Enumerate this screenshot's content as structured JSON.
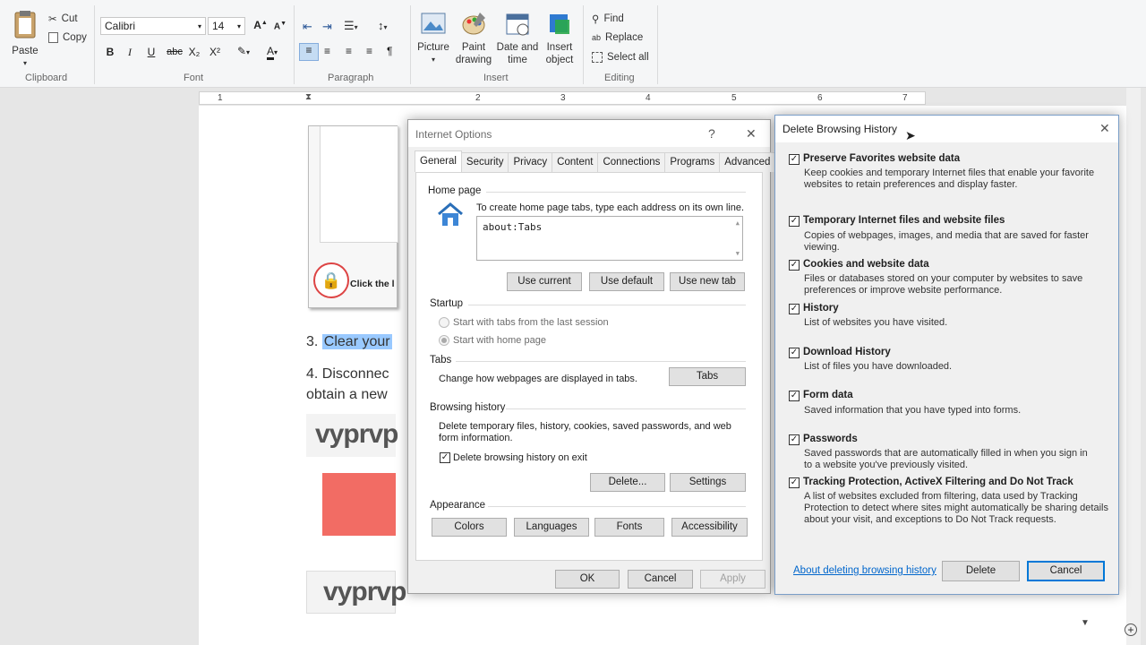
{
  "ribbon": {
    "clipboard": {
      "paste": "Paste",
      "cut": "Cut",
      "copy": "Copy",
      "label": "Clipboard"
    },
    "font": {
      "family": "Calibri",
      "size": "14",
      "label": "Font",
      "bold": "B",
      "italic": "I",
      "underline": "U",
      "strike": "abc",
      "sub": "X₂",
      "sup": "X²",
      "color_glyph": "A"
    },
    "paragraph": {
      "label": "Paragraph"
    },
    "insert": {
      "picture": "Picture",
      "paint_1": "Paint",
      "paint_2": "drawing",
      "date_1": "Date and",
      "date_2": "time",
      "insert_obj_1": "Insert",
      "insert_obj_2": "object",
      "label": "Insert"
    },
    "editing": {
      "find": "Find",
      "replace": "Replace",
      "select_all": "Select all",
      "label": "Editing"
    }
  },
  "ruler": {
    "marks": [
      "1",
      "2",
      "3",
      "4",
      "5",
      "6",
      "7"
    ]
  },
  "document": {
    "img_caption": "Click the l",
    "step3_num": "3.",
    "step3_text": "Clear your",
    "step4_line1": "4. Disconnec",
    "step4_line2": "obtain a new",
    "logo1": "vyprvp",
    "logo2": "vyprvp"
  },
  "internet_options": {
    "title": "Internet Options",
    "help": "?",
    "close": "✕",
    "tabs": [
      "General",
      "Security",
      "Privacy",
      "Content",
      "Connections",
      "Programs",
      "Advanced"
    ],
    "home_page": {
      "heading": "Home page",
      "desc": "To create home page tabs, type each address on its own line.",
      "value": "about:Tabs",
      "use_current": "Use current",
      "use_default": "Use default",
      "use_new_tab": "Use new tab"
    },
    "startup": {
      "heading": "Startup",
      "opt1": "Start with tabs from the last session",
      "opt2": "Start with home page"
    },
    "tabs_section": {
      "heading": "Tabs",
      "desc": "Change how webpages are displayed in tabs.",
      "button": "Tabs"
    },
    "browsing_history": {
      "heading": "Browsing history",
      "desc_1": "Delete temporary files, history, cookies, saved passwords, and web",
      "desc_2": "form information.",
      "checkbox": "Delete browsing history on exit",
      "delete": "Delete...",
      "settings": "Settings"
    },
    "appearance": {
      "heading": "Appearance",
      "colors": "Colors",
      "languages": "Languages",
      "fonts": "Fonts",
      "accessibility": "Accessibility"
    },
    "ok": "OK",
    "cancel": "Cancel",
    "apply": "Apply"
  },
  "delete_history": {
    "title": "Delete Browsing History",
    "close": "✕",
    "items": [
      {
        "title": "Preserve Favorites website data",
        "desc_1": "Keep cookies and temporary Internet files that enable your favorite",
        "desc_2": "websites to retain preferences and display faster.",
        "desc_3": "",
        "checked": true
      },
      {
        "title": "Temporary Internet files and website files",
        "desc_1": "Copies of webpages, images, and media that are saved for faster",
        "desc_2": "viewing.",
        "desc_3": "",
        "checked": true
      },
      {
        "title": "Cookies and website data",
        "desc_1": "Files or databases stored on your computer by websites to save",
        "desc_2": "preferences or improve website performance.",
        "desc_3": "",
        "checked": true
      },
      {
        "title": "History",
        "desc_1": "List of websites you have visited.",
        "desc_2": "",
        "desc_3": "",
        "checked": true
      },
      {
        "title": "Download History",
        "desc_1": "List of files you have downloaded.",
        "desc_2": "",
        "desc_3": "",
        "checked": true
      },
      {
        "title": "Form data",
        "desc_1": "Saved information that you have typed into forms.",
        "desc_2": "",
        "desc_3": "",
        "checked": true
      },
      {
        "title": "Passwords",
        "desc_1": "Saved passwords that are automatically filled in when you sign in",
        "desc_2": "to a website you've previously visited.",
        "desc_3": "",
        "checked": true
      },
      {
        "title": "Tracking Protection, ActiveX Filtering and Do Not Track",
        "desc_1": "A list of websites excluded from filtering, data used by Tracking",
        "desc_2": "Protection to detect where sites might automatically be sharing details",
        "desc_3": "about your visit, and exceptions to Do Not Track requests.",
        "checked": true
      }
    ],
    "about_link": "About deleting browsing history",
    "delete": "Delete",
    "cancel": "Cancel"
  },
  "colors": {
    "accent": "#0078d7",
    "link": "#0066cc",
    "highlight": "#99c9ff",
    "red_button": "#f26c64"
  }
}
